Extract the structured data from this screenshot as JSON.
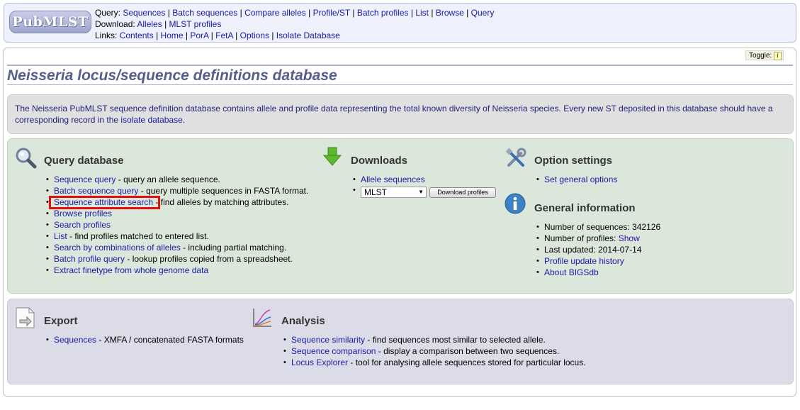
{
  "menu": {
    "logo_text": "PubMLST",
    "query_label": "Query:",
    "query_links": [
      "Sequences",
      "Batch sequences",
      "Compare alleles",
      "Profile/ST",
      "Batch profiles",
      "List",
      "Browse",
      "Query"
    ],
    "download_label": "Download:",
    "download_links": [
      "Alleles",
      "MLST profiles"
    ],
    "links_label": "Links:",
    "links_links": [
      "Contents",
      "Home",
      "PorA",
      "FetA",
      "Options",
      "Isolate Database"
    ]
  },
  "toggle": {
    "label": "Toggle:",
    "icon": "i"
  },
  "page_title": "Neisseria locus/sequence definitions database",
  "intro": {
    "text_before": "The Neisseria PubMLST sequence definition database contains allele and profile data representing the total known diversity of Neisseria species. Every new ST deposited in this database should have a corresponding record in the ",
    "link": "isolate database",
    "text_after": "."
  },
  "query_database": {
    "heading": "Query database",
    "items": [
      {
        "link": "Sequence query",
        "desc": " - query an allele sequence."
      },
      {
        "link": "Batch sequence query",
        "desc": " - query multiple sequences in FASTA format."
      },
      {
        "link": "Sequence attribute search",
        "desc": " - find alleles by matching attributes."
      },
      {
        "link": "Browse profiles",
        "desc": ""
      },
      {
        "link": "Search profiles",
        "desc": ""
      },
      {
        "link": "List",
        "desc": " - find profiles matched to entered list."
      },
      {
        "link": "Search by combinations of alleles",
        "desc": " - including partial matching."
      },
      {
        "link": "Batch profile query",
        "desc": " - lookup profiles copied from a spreadsheet."
      },
      {
        "link": "Extract finetype from whole genome data",
        "desc": ""
      }
    ]
  },
  "downloads": {
    "heading": "Downloads",
    "allele_link": "Allele sequences",
    "select_value": "MLST",
    "button_label": "Download profiles"
  },
  "option_settings": {
    "heading": "Option settings",
    "link": "Set general options"
  },
  "general_information": {
    "heading": "General information",
    "num_sequences_label": "Number of sequences: ",
    "num_sequences": "342126",
    "num_profiles_label": "Number of profiles: ",
    "num_profiles_link": "Show",
    "last_updated_label": "Last updated: ",
    "last_updated": "2014-07-14",
    "history_link": "Profile update history",
    "about_link": "About BIGSdb"
  },
  "export": {
    "heading": "Export",
    "link": "Sequences",
    "desc": " - XMFA / concatenated FASTA formats"
  },
  "analysis": {
    "heading": "Analysis",
    "items": [
      {
        "link": "Sequence similarity",
        "desc": " - find sequences most similar to selected allele."
      },
      {
        "link": "Sequence comparison",
        "desc": " - display a comparison between two sequences."
      },
      {
        "link": "Locus Explorer",
        "desc": " - tool for analysing allele sequences stored for particular locus."
      }
    ]
  },
  "colors": {
    "link": "#1a1aa6",
    "title": "#565e8c",
    "highlight": "#e01010",
    "query_panel": "#dce7dc",
    "export_panel": "#dcdce8"
  }
}
